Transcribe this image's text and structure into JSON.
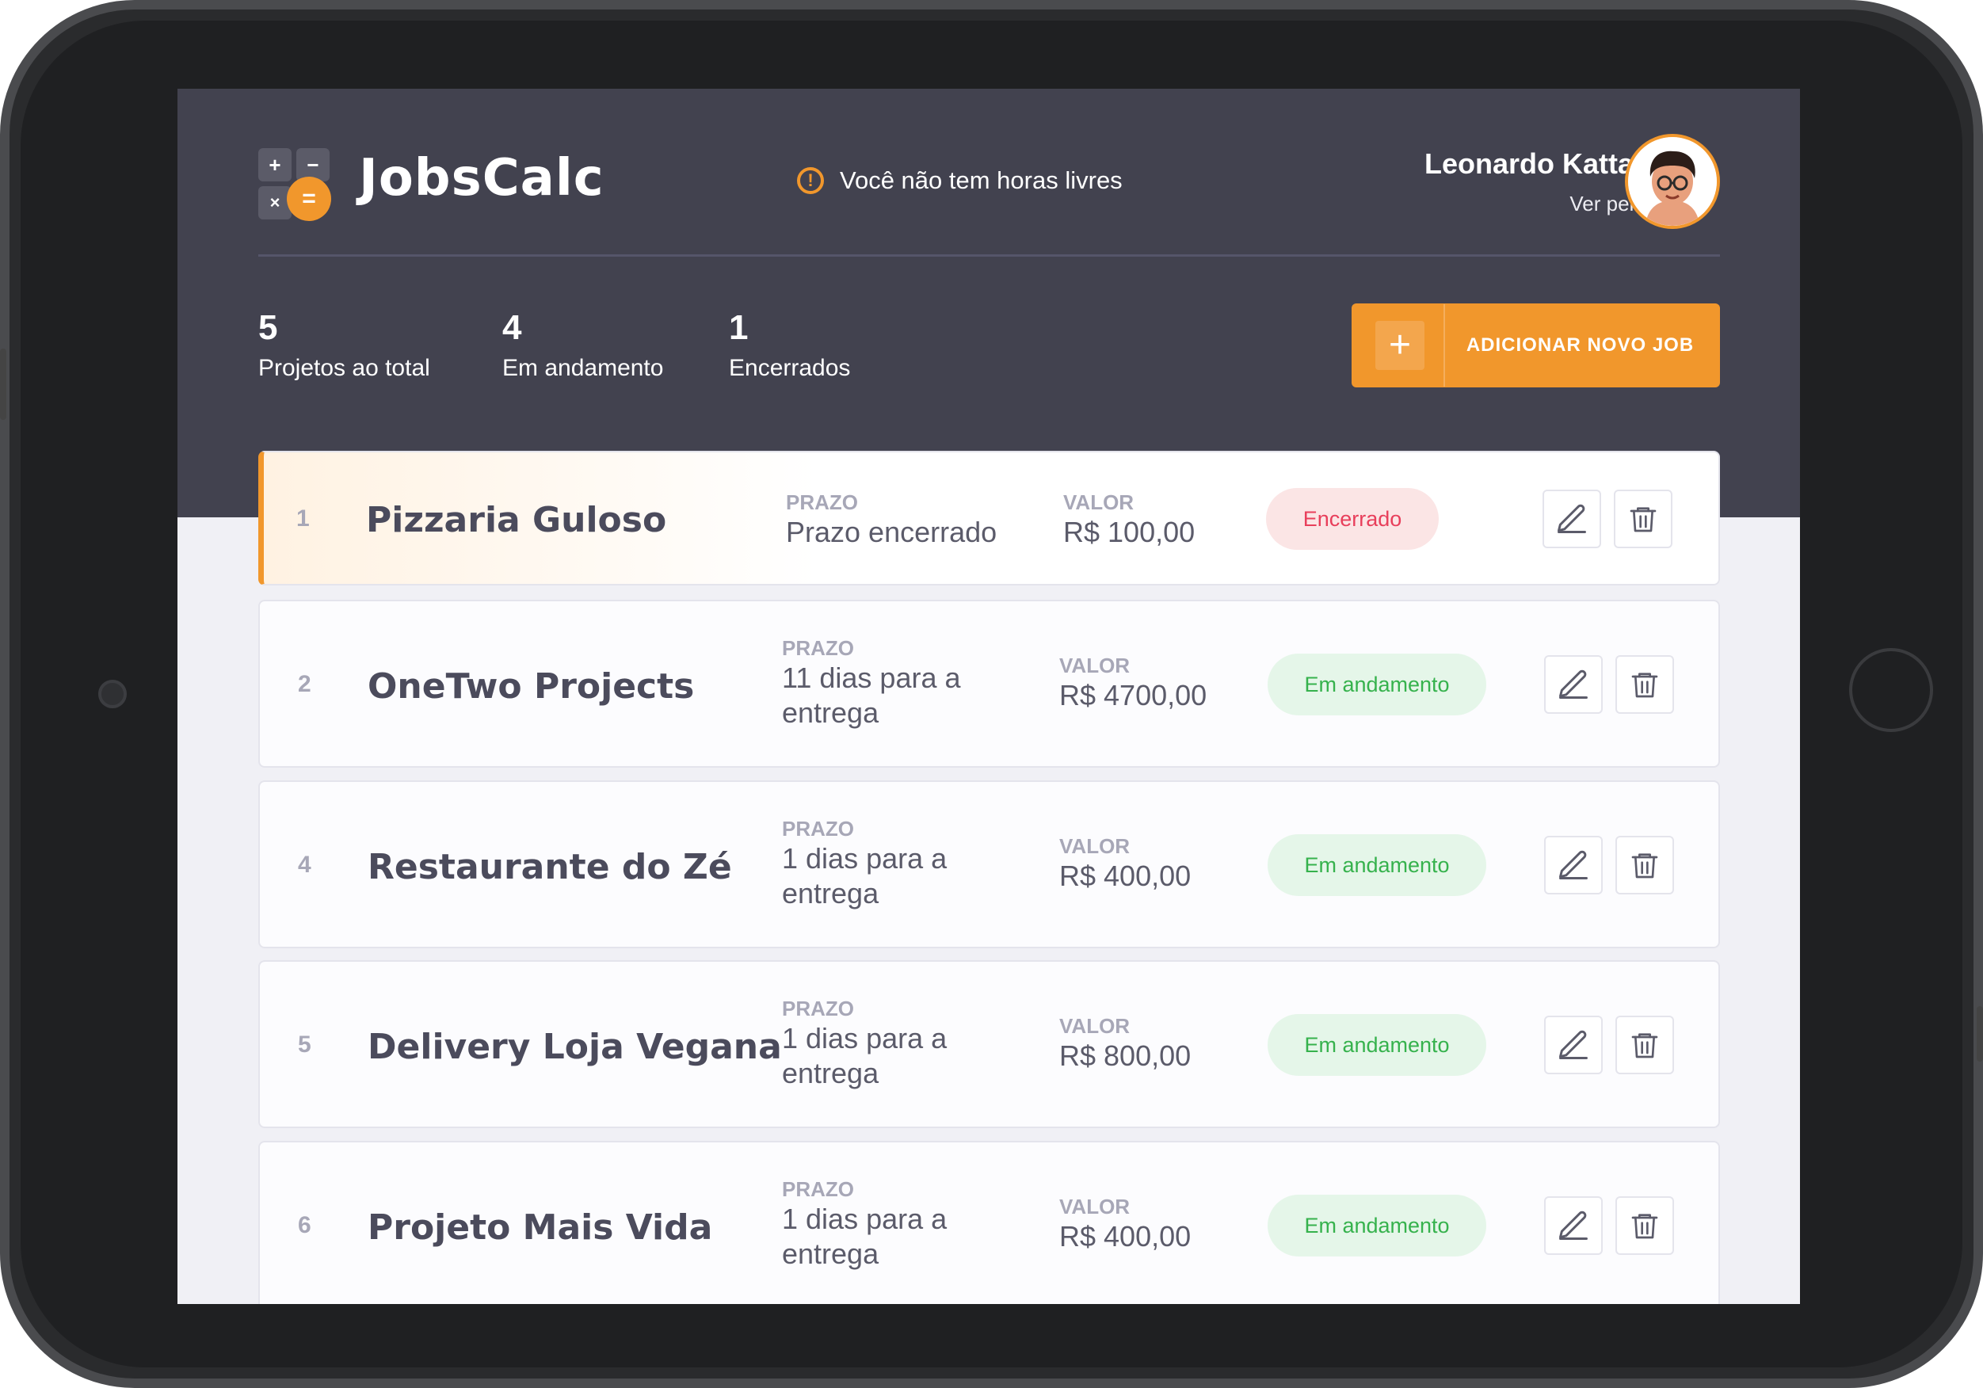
{
  "app": {
    "title": "JobsCalc"
  },
  "alert": {
    "text": "Você não tem horas livres",
    "icon": "alert-circle-icon"
  },
  "profile": {
    "name": "Leonardo Kattah",
    "link": "Ver perfil"
  },
  "stats": [
    {
      "value": "5",
      "label": "Projetos ao total"
    },
    {
      "value": "4",
      "label": "Em andamento"
    },
    {
      "value": "1",
      "label": "Encerrados"
    }
  ],
  "add_button": {
    "label": "ADICIONAR NOVO JOB",
    "icon": "plus-icon"
  },
  "labels": {
    "prazo": "PRAZO",
    "valor": "VALOR"
  },
  "jobs": [
    {
      "index": "1",
      "name": "Pizzaria Guloso",
      "prazo": "Prazo encerrado",
      "valor": "R$ 100,00",
      "status": "Encerrado"
    },
    {
      "index": "2",
      "name": "OneTwo Projects",
      "prazo": "11 dias para a entrega",
      "valor": "R$ 4700,00",
      "status": "Em andamento"
    },
    {
      "index": "4",
      "name": "Restaurante do Zé",
      "prazo": "1 dias para a entrega",
      "valor": "R$ 400,00",
      "status": "Em andamento"
    },
    {
      "index": "5",
      "name": "Delivery Loja Vegana",
      "prazo": "1 dias para a entrega",
      "valor": "R$ 800,00",
      "status": "Em andamento"
    },
    {
      "index": "6",
      "name": "Projeto Mais Vida",
      "prazo": "1 dias para a entrega",
      "valor": "R$ 400,00",
      "status": "Em andamento"
    }
  ],
  "colors": {
    "accent": "#f1972c",
    "header": "#42424f",
    "closed": "#e83f5b",
    "progress": "#36b24d"
  }
}
